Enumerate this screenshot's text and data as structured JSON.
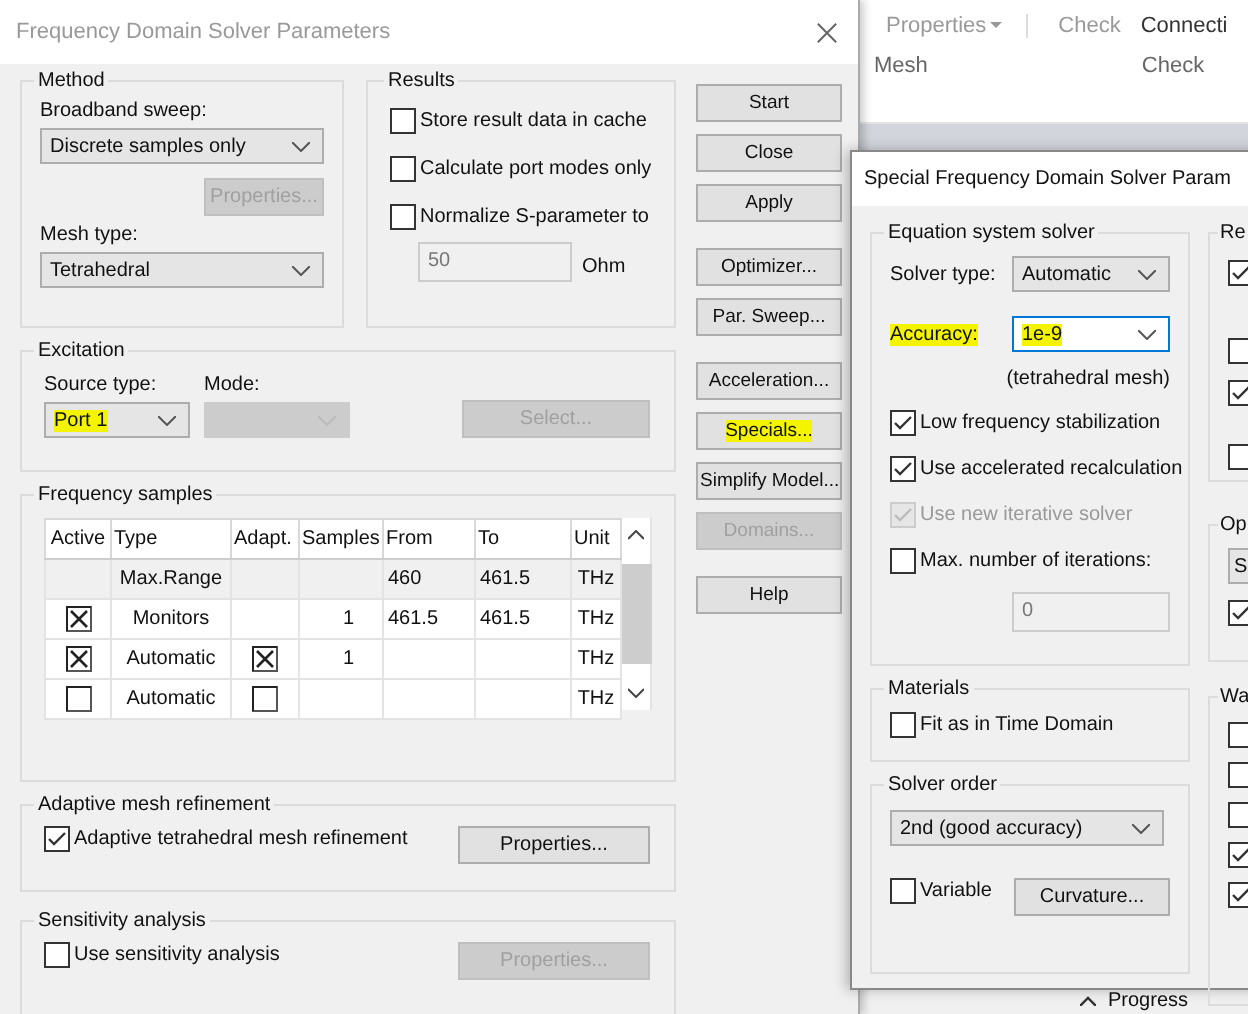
{
  "app_ribbon": {
    "items": [
      {
        "label": "Properties",
        "dropdown": true,
        "disabled": true
      },
      {
        "label": "Check",
        "dropdown": false,
        "disabled": true
      },
      {
        "label": "Connecti",
        "dropdown": false,
        "disabled": false
      }
    ],
    "groups": [
      "Mesh",
      "Check"
    ]
  },
  "main_dialog": {
    "title": "Frequency Domain Solver Parameters",
    "method": {
      "title": "Method",
      "broadband_label": "Broadband sweep:",
      "broadband_value": "Discrete samples only",
      "properties_button": {
        "label": "Properties...",
        "disabled": true
      },
      "mesh_label": "Mesh type:",
      "mesh_value": "Tetrahedral"
    },
    "results": {
      "title": "Results",
      "options": [
        {
          "label": "Store result data in cache",
          "checked": false
        },
        {
          "label": "Calculate port modes only",
          "checked": false
        },
        {
          "label": "Normalize S-parameter to",
          "checked": false
        }
      ],
      "impedance": {
        "value": "50",
        "disabled": true
      },
      "unit": "Ohm"
    },
    "excitation": {
      "title": "Excitation",
      "source_label": "Source type:",
      "source": {
        "value": "Port 1",
        "highlighted": true
      },
      "mode_label": "Mode:",
      "mode": {
        "disabled": true
      },
      "select_button": {
        "label": "Select...",
        "disabled": true
      }
    },
    "frequency_samples": {
      "title": "Frequency samples",
      "columns": [
        "Active",
        "Type",
        "Adapt.",
        "Samples",
        "From",
        "To",
        "Unit"
      ],
      "rows": [
        {
          "kind": "range",
          "type": "Max.Range",
          "from": "460",
          "to": "461.5",
          "unit": "THz"
        },
        {
          "kind": "sample",
          "active": true,
          "type": "Monitors",
          "samples": "1",
          "from": "461.5",
          "to": "461.5",
          "unit": "THz"
        },
        {
          "kind": "sample",
          "active": true,
          "type": "Automatic",
          "adapt": true,
          "samples": "1",
          "unit": "THz"
        },
        {
          "kind": "sample",
          "active": false,
          "type": "Automatic",
          "adapt": false,
          "unit": "THz"
        }
      ]
    },
    "adaptive_mesh": {
      "title": "Adaptive mesh refinement",
      "option": {
        "label": "Adaptive tetrahedral mesh refinement",
        "checked": true
      },
      "properties_button": {
        "label": "Properties...",
        "disabled": false
      }
    },
    "sensitivity": {
      "title": "Sensitivity analysis",
      "option": {
        "label": "Use sensitivity analysis",
        "checked": false
      },
      "properties_button": {
        "label": "Properties...",
        "disabled": true
      }
    },
    "button_groups": [
      [
        {
          "label": "Start",
          "disabled": false,
          "highlighted": false
        },
        {
          "label": "Close",
          "disabled": false,
          "highlighted": false
        },
        {
          "label": "Apply",
          "disabled": false,
          "highlighted": false
        }
      ],
      [
        {
          "label": "Optimizer...",
          "disabled": false,
          "highlighted": false
        },
        {
          "label": "Par. Sweep...",
          "disabled": false,
          "highlighted": false
        }
      ],
      [
        {
          "label": "Acceleration...",
          "disabled": false,
          "highlighted": false
        },
        {
          "label": "Specials...",
          "disabled": false,
          "highlighted": true
        },
        {
          "label": "Simplify Model...",
          "disabled": false,
          "highlighted": false
        },
        {
          "label": "Domains...",
          "disabled": true,
          "highlighted": false
        }
      ],
      [
        {
          "label": "Help",
          "disabled": false,
          "highlighted": false
        }
      ]
    ]
  },
  "special_dialog": {
    "title": "Special Frequency Domain Solver Param",
    "equation_solver": {
      "title": "Equation system solver",
      "solver_type_label": "Solver type:",
      "solver_type": "Automatic",
      "accuracy_label": "Accuracy:",
      "accuracy_highlighted": true,
      "accuracy": "1e-9",
      "accuracy_note": "(tetrahedral mesh)",
      "options": [
        {
          "label": "Low frequency stabilization",
          "checked": true,
          "disabled": false
        },
        {
          "label": "Use accelerated recalculation",
          "checked": true,
          "disabled": false
        },
        {
          "label": "Use new iterative solver",
          "checked": true,
          "disabled": true
        },
        {
          "label": "Max. number of iterations:",
          "checked": false,
          "disabled": false
        }
      ],
      "iterations": {
        "value": "0",
        "disabled": true
      }
    },
    "materials": {
      "title": "Materials",
      "option": {
        "label": "Fit as in Time Domain",
        "checked": false
      }
    },
    "solver_order": {
      "title": "Solver order",
      "value": "2nd (good accuracy)",
      "variable": {
        "label": "Variable",
        "checked": false
      },
      "curvature_button": "Curvature..."
    },
    "right_groups": [
      {
        "kind": "checks",
        "title": "Re",
        "checks": [
          true,
          false,
          true,
          false
        ]
      },
      {
        "kind": "dropdown",
        "title": "Op",
        "dropdown": "S",
        "checks": [
          true
        ]
      },
      {
        "kind": "checks",
        "title": "Wa",
        "checks": [
          false,
          false,
          false,
          true,
          true
        ]
      }
    ]
  },
  "status_bar": {
    "label": "Progress"
  }
}
